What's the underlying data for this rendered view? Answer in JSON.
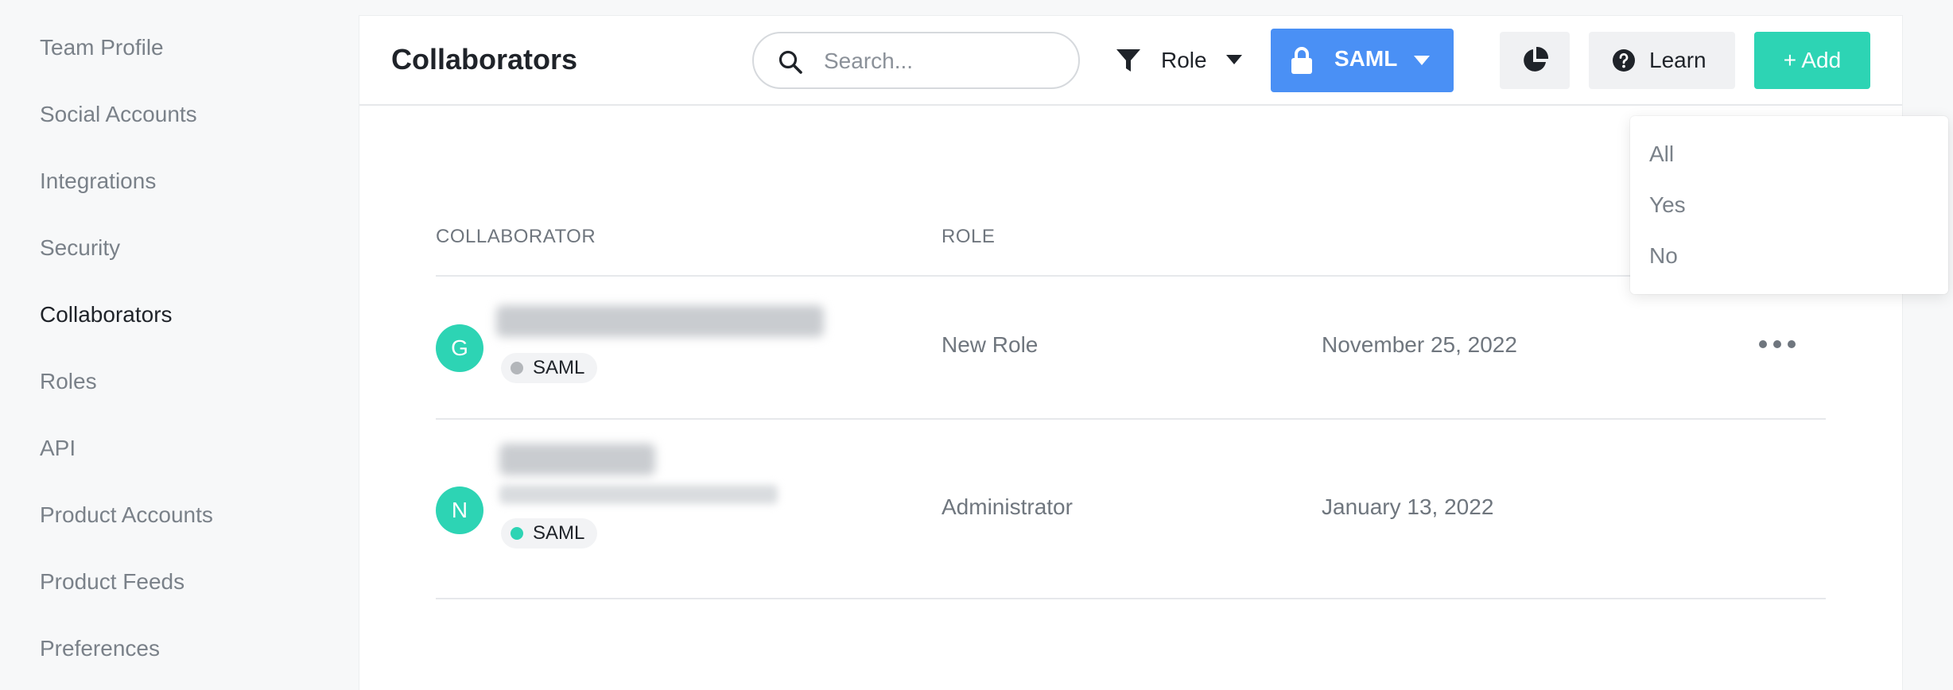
{
  "sidebar": {
    "items": [
      {
        "label": "Team Profile"
      },
      {
        "label": "Social Accounts"
      },
      {
        "label": "Integrations"
      },
      {
        "label": "Security"
      },
      {
        "label": "Collaborators",
        "active": true
      },
      {
        "label": "Roles"
      },
      {
        "label": "API"
      },
      {
        "label": "Product Accounts"
      },
      {
        "label": "Product Feeds"
      },
      {
        "label": "Preferences"
      }
    ]
  },
  "header": {
    "title": "Collaborators",
    "search_placeholder": "Search...",
    "role_filter_label": "Role",
    "saml_filter_label": "SAML",
    "learn_label": "Learn",
    "add_label": "+ Add"
  },
  "saml_dropdown": {
    "options": [
      "All",
      "Yes",
      "No"
    ]
  },
  "table": {
    "columns": [
      "COLLABORATOR",
      "ROLE"
    ],
    "rows": [
      {
        "initial": "G",
        "badge": "SAML",
        "badge_status": "inactive",
        "role": "New Role",
        "date": "November 25, 2022"
      },
      {
        "initial": "N",
        "badge": "SAML",
        "badge_status": "active",
        "role": "Administrator",
        "date": "January 13, 2022"
      }
    ]
  },
  "colors": {
    "accent_blue": "#4a90f5",
    "accent_teal": "#2dd4b4",
    "badge_inactive": "#b3b6ba",
    "badge_active": "#2dd4b4"
  },
  "icons": {
    "search": "search-icon",
    "role_filter": "funnel-icon",
    "saml": "lock-icon",
    "stats": "pie-chart-icon",
    "learn": "question-circle-icon",
    "row_actions": "more-horizontal-icon"
  }
}
